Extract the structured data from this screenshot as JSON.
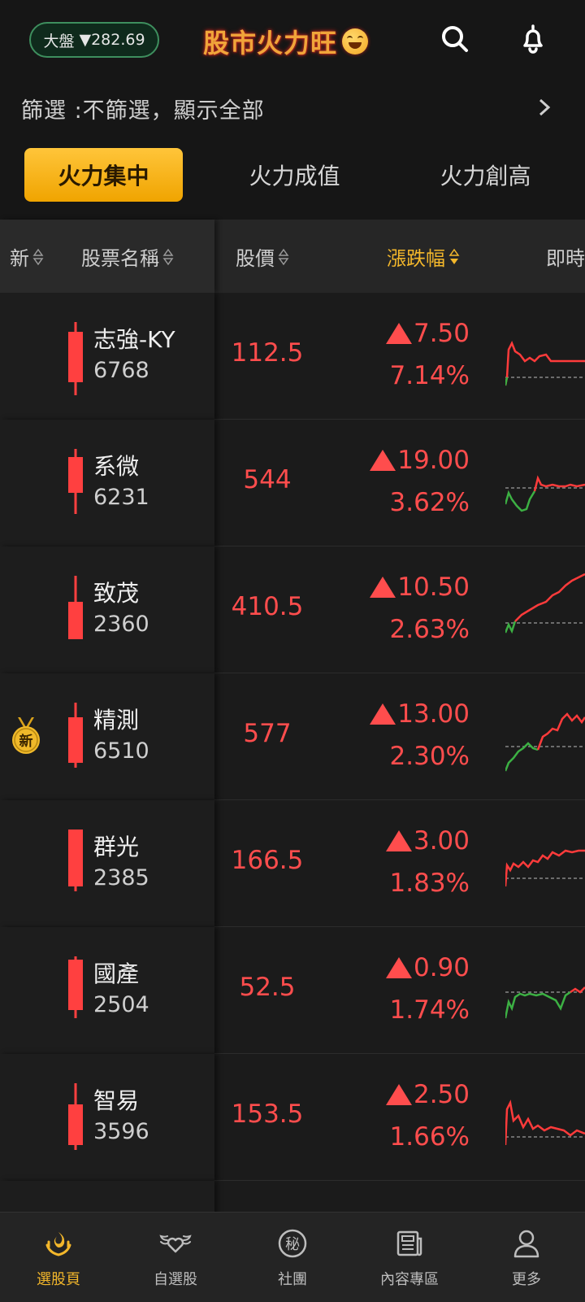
{
  "header": {
    "market_label": "大盤",
    "market_change": "▼282.69",
    "app_title": "股市火力旺"
  },
  "filter": {
    "text": "篩選 :不篩選，顯示全部"
  },
  "tabs": [
    {
      "label": "火力集中",
      "active": true
    },
    {
      "label": "火力成值",
      "active": false
    },
    {
      "label": "火力創高",
      "active": false
    }
  ],
  "columns": {
    "new": "新",
    "name": "股票名稱",
    "price": "股價",
    "change": "漲跌幅",
    "realtime": "即時"
  },
  "stocks": [
    {
      "name": "志強-KY",
      "code": "6768",
      "price": "112.5",
      "change": "7.50",
      "pct": "7.14%",
      "is_new": false
    },
    {
      "name": "系微",
      "code": "6231",
      "price": "544",
      "change": "19.00",
      "pct": "3.62%",
      "is_new": false
    },
    {
      "name": "致茂",
      "code": "2360",
      "price": "410.5",
      "change": "10.50",
      "pct": "2.63%",
      "is_new": false
    },
    {
      "name": "精測",
      "code": "6510",
      "price": "577",
      "change": "13.00",
      "pct": "2.30%",
      "is_new": true
    },
    {
      "name": "群光",
      "code": "2385",
      "price": "166.5",
      "change": "3.00",
      "pct": "1.83%",
      "is_new": false
    },
    {
      "name": "國產",
      "code": "2504",
      "price": "52.5",
      "change": "0.90",
      "pct": "1.74%",
      "is_new": false
    },
    {
      "name": "智易",
      "code": "3596",
      "price": "153.5",
      "change": "2.50",
      "pct": "1.66%",
      "is_new": false
    }
  ],
  "new_badge_text": "新",
  "nav": [
    {
      "label": "選股頁",
      "active": true
    },
    {
      "label": "自選股",
      "active": false
    },
    {
      "label": "社團",
      "active": false
    },
    {
      "label": "內容專區",
      "active": false
    },
    {
      "label": "更多",
      "active": false
    }
  ],
  "community_icon_glyph": "秘",
  "colors": {
    "up": "#ff4d4d",
    "down": "#3cb043",
    "accent": "#f3b72b",
    "market_pill_border": "#3e8f5e"
  }
}
